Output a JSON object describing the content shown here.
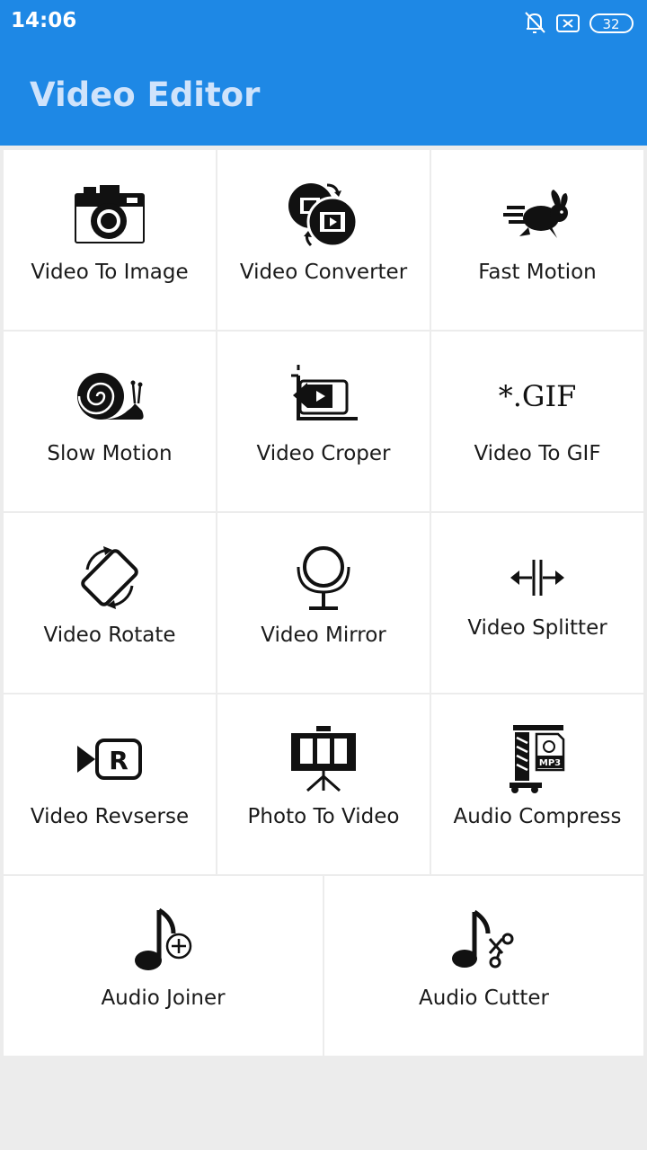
{
  "status_bar": {
    "time": "14:06",
    "battery": "32"
  },
  "app_bar": {
    "title": "Video Editor",
    "color": "#1e88e5"
  },
  "tools": [
    {
      "label": "Video To Image",
      "icon": "camera-icon"
    },
    {
      "label": "Video Converter",
      "icon": "convert-icon"
    },
    {
      "label": "Fast Motion",
      "icon": "rabbit-icon"
    },
    {
      "label": "Slow Motion",
      "icon": "snail-icon"
    },
    {
      "label": "Video Croper",
      "icon": "crop-video-icon"
    },
    {
      "label": "Video To GIF",
      "icon": "gif-icon",
      "icon_text": "*.GIF"
    },
    {
      "label": "Video Rotate",
      "icon": "rotate-icon"
    },
    {
      "label": "Video Mirror",
      "icon": "mirror-icon"
    },
    {
      "label": "Video Splitter",
      "icon": "split-icon"
    },
    {
      "label": "Video Revserse",
      "icon": "reverse-icon",
      "icon_text": "R"
    },
    {
      "label": "Photo To Video",
      "icon": "projector-icon"
    },
    {
      "label": "Audio Compress",
      "icon": "compress-icon",
      "icon_text": "MP3"
    },
    {
      "label": "Audio Joiner",
      "icon": "music-plus-icon"
    },
    {
      "label": "Audio Cutter",
      "icon": "music-scissors-icon"
    }
  ]
}
